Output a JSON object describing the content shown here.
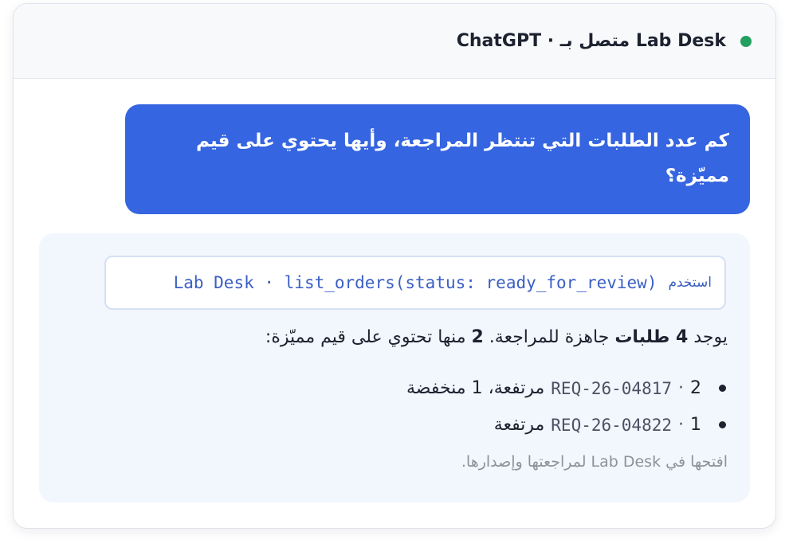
{
  "header": {
    "title": "ChatGPT · متصل بـ Lab Desk",
    "status_color": "#22a060"
  },
  "user_message": {
    "text": "كم عدد الطلبات التي تنتظر المراجعة، وأيها يحتوي على قيم مميّزة؟"
  },
  "tool_call": {
    "used_label": "استخدم",
    "call": "Lab Desk · list_orders(status: ready_for_review)"
  },
  "reply": {
    "summary_pre": "يوجد",
    "summary_total": "4 طلبات",
    "summary_mid": "جاهزة للمراجعة.",
    "summary_flagged": "2",
    "summary_post": "منها تحتوي على قيم مميّزة:",
    "items": [
      {
        "count": "2",
        "order_id": "REQ-26-04817",
        "flags": "مرتفعة، 1 منخفضة"
      },
      {
        "count": "1",
        "order_id": "REQ-26-04822",
        "flags": "مرتفعة"
      }
    ],
    "note": "افتحها في Lab Desk لمراجعتها وإصدارها."
  },
  "colors": {
    "user_bubble": "#3565e0",
    "reply_background": "#f2f6fd",
    "tool_text": "#3b5fc4",
    "note_text": "#8c919b"
  }
}
